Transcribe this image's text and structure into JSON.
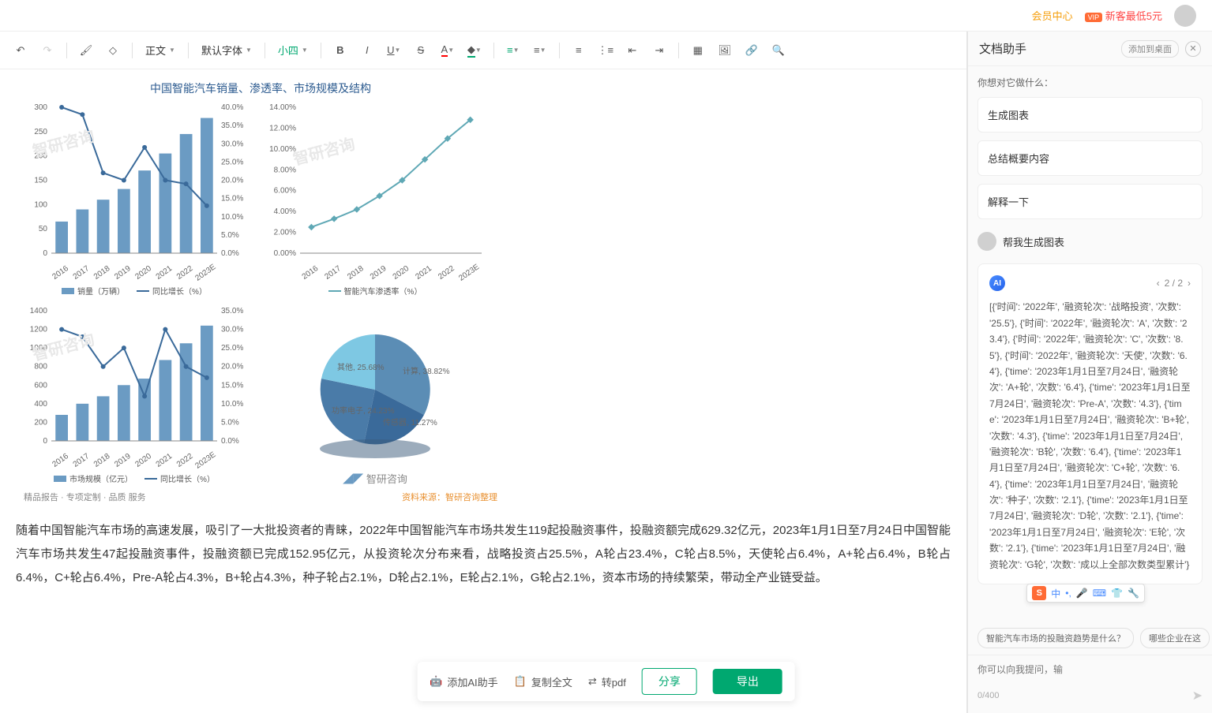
{
  "header": {
    "member": "会员中心",
    "promo": "新客最低5元"
  },
  "toolbar": {
    "paragraph": "正文",
    "font": "默认字体",
    "size": "小四"
  },
  "chart_title": "中国智能汽车销量、渗透率、市场规模及结构",
  "chart_data": [
    {
      "type": "bar",
      "title": "销量",
      "categories": [
        "2016",
        "2017",
        "2018",
        "2019",
        "2020",
        "2021",
        "2022",
        "2023E"
      ],
      "series": [
        {
          "name": "销量（万辆）",
          "values": [
            65,
            90,
            110,
            132,
            170,
            205,
            245,
            278
          ]
        },
        {
          "name": "同比增长（%）",
          "values": [
            40,
            38,
            22,
            20,
            29,
            20,
            19,
            13
          ]
        }
      ],
      "y1": {
        "min": 0,
        "max": 300,
        "step": 50
      },
      "y2": {
        "min": 0,
        "max": 40,
        "step": 5,
        "suffix": "%"
      }
    },
    {
      "type": "line",
      "title": "渗透率",
      "categories": [
        "2016",
        "2017",
        "2018",
        "2019",
        "2020",
        "2021",
        "2022",
        "2023E"
      ],
      "series": [
        {
          "name": "智能汽车渗透率（%）",
          "values": [
            2.5,
            3.3,
            4.2,
            5.5,
            7.0,
            9.0,
            11.0,
            12.8
          ]
        }
      ],
      "y": {
        "min": 0,
        "max": 14,
        "step": 2,
        "suffix": "%"
      }
    },
    {
      "type": "bar",
      "title": "市场规模",
      "categories": [
        "2016",
        "2017",
        "2018",
        "2019",
        "2020",
        "2021",
        "2022",
        "2023E"
      ],
      "series": [
        {
          "name": "市场规模（亿元）",
          "values": [
            280,
            400,
            480,
            600,
            670,
            870,
            1050,
            1240
          ]
        },
        {
          "name": "同比增长（%）",
          "values": [
            30,
            28,
            20,
            25,
            12,
            30,
            20,
            17
          ]
        }
      ],
      "y1": {
        "min": 0,
        "max": 1400,
        "step": 200
      },
      "y2": {
        "min": 0,
        "max": 35,
        "step": 5,
        "suffix": "%"
      }
    },
    {
      "type": "pie",
      "title": "结构",
      "slices": [
        {
          "name": "计算",
          "value": 38.82,
          "color": "#5b8db5"
        },
        {
          "name": "其他",
          "value": 25.68,
          "color": "#7ec8e3"
        },
        {
          "name": "功率电子",
          "value": 24.23,
          "color": "#4a7ba8"
        },
        {
          "name": "传感器",
          "value": 11.27,
          "color": "#3a6a9a"
        }
      ]
    }
  ],
  "legends": {
    "c1a": "销量（万辆）",
    "c1b": "同比增长（%）",
    "c2": "智能汽车渗透率（%）",
    "c3a": "市场规模（亿元）",
    "c3b": "同比增长（%）"
  },
  "pie_labels": {
    "calc": "计算,\n38.82%",
    "other": "其他,\n25.68%",
    "power": "功率电子,\n24.23%",
    "sensor": "传感器,\n11.27%"
  },
  "brand": "智研咨询",
  "source": {
    "left": "精品报告 · 专项定制 · 品质 服务",
    "right": "资料来源：智研咨询整理"
  },
  "paragraph": "随着中国智能汽车市场的高速发展，吸引了一大批投资者的青睐，2022年中国智能汽车市场共发生119起投融资事件，投融资额完成629.32亿元，2023年1月1日至7月24日中国智能汽车市场共发生47起投融资事件，投融资额已完成152.95亿元，从投资轮次分布来看，战略投资占25.5%，A轮占23.4%，C轮占8.5%，天使轮占6.4%，A+轮占6.4%，B轮占6.4%，C+轮占6.4%，Pre-A轮占4.3%，B+轮占4.3%，种子轮占2.1%，D轮占2.1%，E轮占2.1%，G轮占2.1%，资本市场的持续繁荣，带动全产业链受益。",
  "actions": {
    "ai": "添加AI助手",
    "copy": "复制全文",
    "pdf": "转pdf",
    "share": "分享",
    "export": "导出"
  },
  "assistant": {
    "title": "文档助手",
    "desktop": "添加到桌面",
    "prompt": "你想对它做什么：",
    "suggestions": [
      "生成图表",
      "总结概要内容",
      "解释一下"
    ],
    "user_msg": "帮我生成图表",
    "pager": "2 / 2",
    "response": "[{'时间': '2022年', '融资轮次': '战略投资', '次数': '25.5'}, {'时间': '2022年', '融资轮次': 'A', '次数': '23.4'}, {'时间': '2022年', '融资轮次': 'C', '次数': '8.5'}, {'时间': '2022年', '融资轮次': '天使', '次数': '6.4'}, {'time': '2023年1月1日至7月24日', '融资轮次': 'A+轮', '次数': '6.4'}, {'time': '2023年1月1日至7月24日', '融资轮次': 'Pre-A', '次数': '4.3'}, {'time': '2023年1月1日至7月24日', '融资轮次': 'B+轮', '次数': '4.3'}, {'time': '2023年1月1日至7月24日', '融资轮次': 'B轮', '次数': '6.4'}, {'time': '2023年1月1日至7月24日', '融资轮次': 'C+轮', '次数': '6.4'}, {'time': '2023年1月1日至7月24日', '融资轮次': '种子', '次数': '2.1'}, {'time': '2023年1月1日至7月24日', '融资轮次': 'D轮', '次数': '2.1'}, {'time': '2023年1月1日至7月24日', '融资轮次': 'E轮', '次数': '2.1'}, {'time': '2023年1月1日至7月24日', '融资轮次': 'G轮', '次数': '成以上全部次数类型累计'}",
    "chips": [
      "智能汽车市场的投融资趋势是什么？",
      "哪些企业在这"
    ],
    "input_placeholder": "你可以向我提问，输",
    "counter": "0/400"
  },
  "ime": {
    "s": "S",
    "lang": "中"
  }
}
